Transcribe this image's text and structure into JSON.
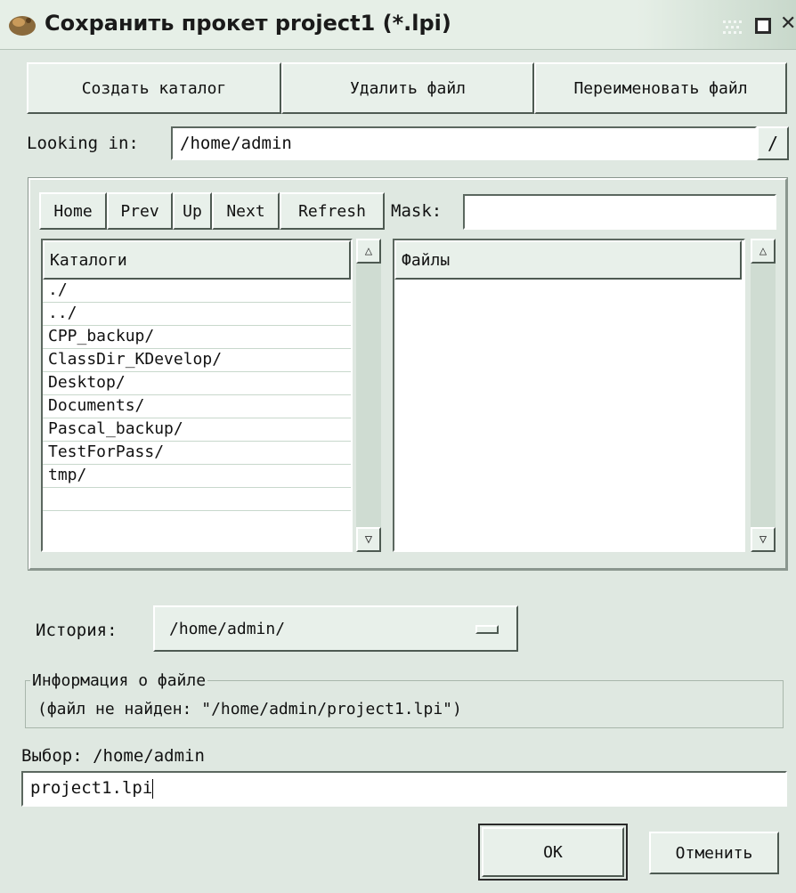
{
  "window": {
    "title": "Сохранить прокет project1 (*.lpi)",
    "icon": "lazarus-app-icon",
    "controls": [
      "dots-icon",
      "maximize-icon",
      "close-icon"
    ]
  },
  "top_buttons": {
    "create_dir": "Создать каталог",
    "delete_file": "Удалить файл",
    "rename_file": "Переименовать файл"
  },
  "looking_in": {
    "label": "Looking in:",
    "value": "/home/admin",
    "dropdown_glyph": "/"
  },
  "nav": {
    "home": "Home",
    "prev": "Prev",
    "up": "Up",
    "next": "Next",
    "refresh": "Refresh",
    "mask_label": "Mask:",
    "mask_value": ""
  },
  "directories": {
    "header": "Каталоги",
    "items": [
      "./",
      "../",
      "CPP_backup/",
      "ClassDir_KDevelop/",
      "Desktop/",
      "Documents/",
      "Pascal_backup/",
      "TestForPass/",
      "tmp/"
    ]
  },
  "files": {
    "header": "Файлы",
    "items": []
  },
  "history": {
    "label": "История:",
    "value": "/home/admin/"
  },
  "file_info": {
    "legend": "Информация о файле",
    "text": "(файл не найден: \"/home/admin/project1.lpi\")"
  },
  "selection": {
    "label": "Выбор: /home/admin",
    "filename": "project1.lpi"
  },
  "actions": {
    "ok": "OK",
    "cancel": "Отменить"
  },
  "colors": {
    "background": "#dfe8e1",
    "field": "#ffffff",
    "row_separator": "#c8d8cc"
  }
}
